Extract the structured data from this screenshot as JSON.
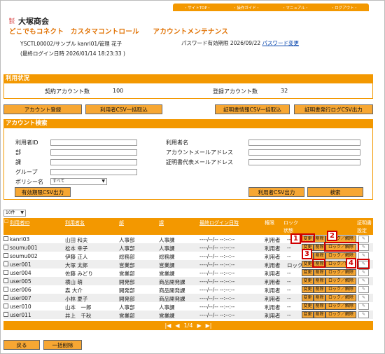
{
  "nav": [
    "・サイトTOP・",
    "・操作ガイド・",
    "・マニュアル・",
    "・ログアウト・"
  ],
  "logo": {
    "mark": "株式会社",
    "name": "大塚商会"
  },
  "app_title": "どこでもコネクト　カスタマコントロール　　アカウントメンテナンス",
  "user": {
    "line1": "YSCTL00002/サンプル kanri01/管理 花子",
    "line2": "(最終ログイン日時 2026/01/14 18:23:33 )"
  },
  "password": {
    "expiry": "パスワード有効期限 2026/09/22",
    "change_link": "パスワード変更"
  },
  "usage": {
    "heading": "利用状況",
    "contract_label": "契約アカウント数",
    "contract_value": "100",
    "registered_label": "登録アカウント数",
    "registered_value": "32"
  },
  "buttons": {
    "register": "アカウント登録",
    "csv_import": "利用者CSV一括取込",
    "cert_import": "証明書情報CSV一括取込",
    "cert_log": "証明書発行ログCSV出力",
    "expiry_csv": "有効期限CSV出力",
    "user_csv": "利用者CSV出力",
    "search": "検索",
    "back": "戻る",
    "bulk_delete": "一括削除"
  },
  "search": {
    "heading": "アカウント検索",
    "labels": {
      "user_id": "利用者ID",
      "dept": "部",
      "section": "課",
      "group": "グループ",
      "policy": "ポリシー名",
      "user_name": "利用者名",
      "mail": "アカウントメールアドレス",
      "cert_mail": "証明書代表メールアドレス"
    },
    "policy_value": "すべて"
  },
  "table": {
    "page_size": "10件",
    "headers": {
      "user_id": "利用者ID",
      "user_name": "利用者名",
      "dept": "部",
      "section": "課",
      "last_login": "最終ログイン日時",
      "auth": "権限",
      "lock": "ロック",
      "status": "状態",
      "cert": "証明書",
      "cert2": "設定"
    },
    "rows": [
      {
        "id": "kanri03",
        "name": "山田 和夫",
        "dept": "人事部",
        "section": "人事課",
        "login": "----/--/-- --:--:--",
        "auth": "利用者",
        "lock": "--"
      },
      {
        "id": "soumu001",
        "name": "松本 幸子",
        "dept": "人事部",
        "section": "人事課",
        "login": "----/--/-- --:--:--",
        "auth": "利用者",
        "lock": "--"
      },
      {
        "id": "soumu002",
        "name": "伊藤 正人",
        "dept": "総務部",
        "section": "総務課",
        "login": "----/--/-- --:--:--",
        "auth": "利用者",
        "lock": "--"
      },
      {
        "id": "user001",
        "name": "大塚 太郎",
        "dept": "営業部",
        "section": "営業課",
        "login": "----/--/-- --:--:--",
        "auth": "利用者",
        "lock": "ロック"
      },
      {
        "id": "user004",
        "name": "佐藤 みどり",
        "dept": "営業部",
        "section": "営業課",
        "login": "----/--/-- --:--:--",
        "auth": "利用者",
        "lock": "--"
      },
      {
        "id": "user005",
        "name": "横山 萌",
        "dept": "開発部",
        "section": "商品開発課",
        "login": "----/--/-- --:--:--",
        "auth": "利用者",
        "lock": "--"
      },
      {
        "id": "user006",
        "name": "森 大介",
        "dept": "開発部",
        "section": "商品開発課",
        "login": "----/--/-- --:--:--",
        "auth": "利用者",
        "lock": "--"
      },
      {
        "id": "user007",
        "name": "小林 夏子",
        "dept": "開発部",
        "section": "商品開発課",
        "login": "----/--/-- --:--:--",
        "auth": "利用者",
        "lock": "--"
      },
      {
        "id": "user010",
        "name": "山本　一郎",
        "dept": "人事部",
        "section": "人事課",
        "login": "----/--/-- --:--:--",
        "auth": "利用者",
        "lock": "--"
      },
      {
        "id": "user011",
        "name": "井上　千秋",
        "dept": "営業部",
        "section": "営業課",
        "login": "----/--/-- --:--:--",
        "auth": "利用者",
        "lock": "--"
      }
    ],
    "row_actions": {
      "edit": "変更",
      "delete": "削除",
      "lock": "ロック／解除"
    }
  },
  "pager": {
    "text": "1/4"
  },
  "callouts": [
    "1",
    "2",
    "3",
    "4"
  ],
  "colors": {
    "accent": "#f39800",
    "button": "#f7a733",
    "callout": "#d00000"
  }
}
